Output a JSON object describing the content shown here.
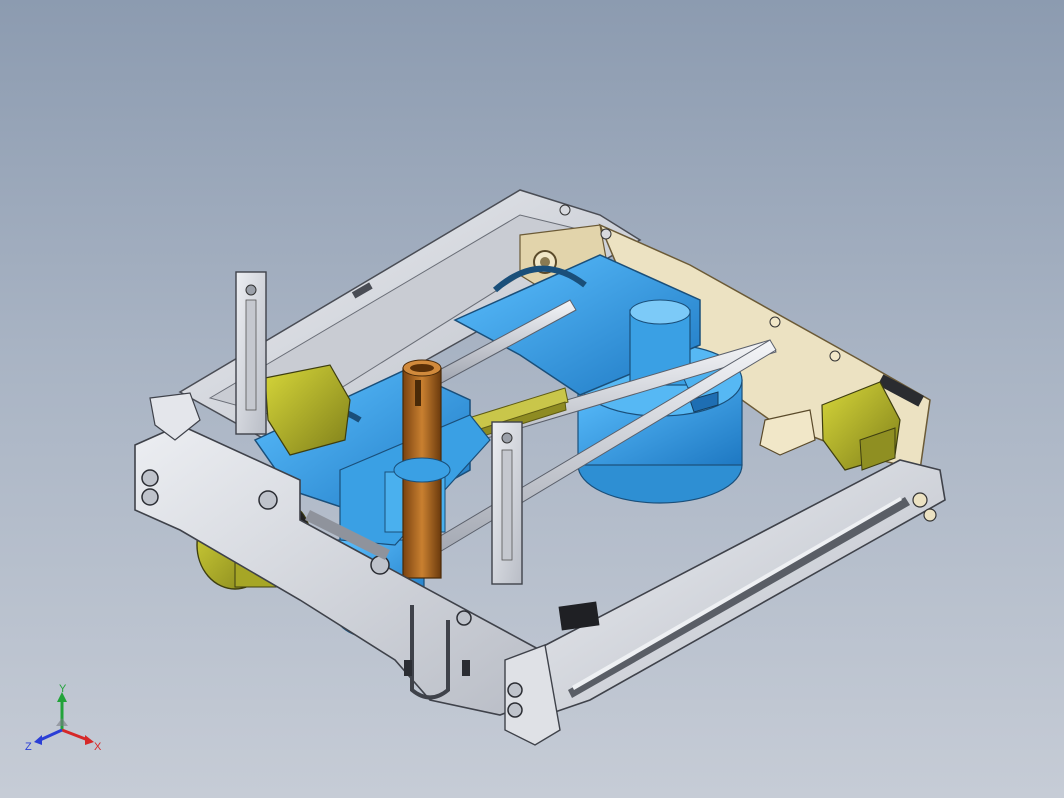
{
  "scene": {
    "background_top": "#8c9bb0",
    "background_bottom": "#c6ccd6"
  },
  "model": {
    "parts": [
      "frame",
      "guide-rods",
      "carriage-left",
      "carriage-right",
      "brass-tube",
      "rack-gear",
      "motor-left",
      "motor-right",
      "vertical-posts",
      "side-rail"
    ]
  },
  "colors": {
    "frame": "#d7d9de",
    "frame_edge": "#4a4d55",
    "blue": "#3fa6e6",
    "blue_dark": "#1f6fb0",
    "brass": "#b06a1c",
    "olive": "#b5b52a",
    "cream": "#ece2c2"
  },
  "triad": {
    "x_label": "X",
    "y_label": "Y",
    "z_label": "Z",
    "x_color": "#d62828",
    "y_color": "#22a33a",
    "z_color": "#2a3ed6"
  }
}
